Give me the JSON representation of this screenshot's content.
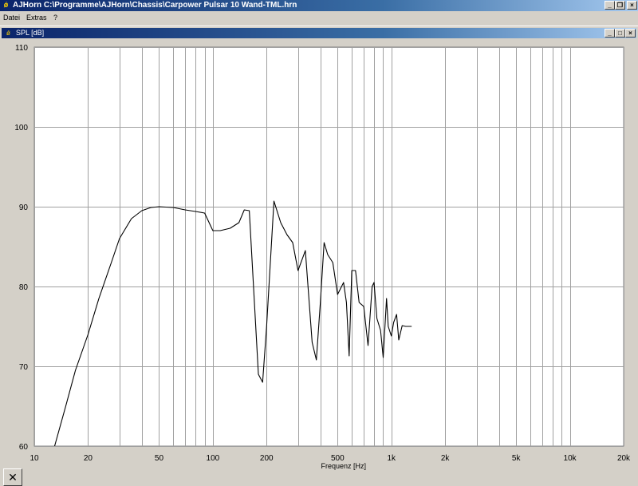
{
  "window": {
    "title": "AJHorn  C:\\Programme\\AJHorn\\Chassis\\Carpower Pulsar 10 Wand-TML.hrn",
    "icon": "aj-icon",
    "buttons": {
      "minimize": "_",
      "restore": "❐",
      "close": "×"
    }
  },
  "menu": {
    "items": [
      "Datei",
      "Extras",
      "?"
    ]
  },
  "subwindow": {
    "title": "SPL [dB]",
    "buttons": {
      "minimize": "_",
      "restore": "□",
      "close": "×"
    }
  },
  "close_button_label": "✕",
  "chart_data": {
    "type": "line",
    "title": "SPL [dB]",
    "xlabel": "Frequenz [Hz]",
    "ylabel": "SPL [dB]",
    "xscale": "log",
    "xlim": [
      10,
      20000
    ],
    "ylim": [
      60,
      110
    ],
    "grid": true,
    "x_ticks": [
      {
        "value": 10,
        "label": "10"
      },
      {
        "value": 20,
        "label": "20"
      },
      {
        "value": 50,
        "label": "50"
      },
      {
        "value": 100,
        "label": "100"
      },
      {
        "value": 200,
        "label": "200"
      },
      {
        "value": 500,
        "label": "500"
      },
      {
        "value": 1000,
        "label": "1k"
      },
      {
        "value": 2000,
        "label": "2k"
      },
      {
        "value": 5000,
        "label": "5k"
      },
      {
        "value": 10000,
        "label": "10k"
      },
      {
        "value": 20000,
        "label": "20k"
      }
    ],
    "y_ticks": [
      60,
      70,
      80,
      90,
      100,
      110
    ],
    "series": [
      {
        "color": "#000000",
        "x": [
          13,
          15,
          17,
          20,
          23,
          27,
          30,
          35,
          40,
          45,
          50,
          60,
          70,
          80,
          90,
          100,
          110,
          125,
          140,
          150,
          160,
          180,
          190,
          200,
          220,
          240,
          260,
          280,
          300,
          330,
          360,
          380,
          400,
          420,
          440,
          470,
          500,
          540,
          560,
          580,
          600,
          630,
          660,
          700,
          740,
          780,
          800,
          830,
          870,
          900,
          940,
          960,
          1000,
          1030,
          1070,
          1100,
          1150,
          1200,
          1250,
          1300
        ],
        "y": [
          60,
          65,
          69.5,
          74,
          78.5,
          83,
          86,
          88.5,
          89.5,
          89.9,
          90,
          89.9,
          89.6,
          89.4,
          89.2,
          87,
          87,
          87.3,
          88,
          89.6,
          89.5,
          69,
          68,
          75,
          90.7,
          88,
          86.5,
          85.5,
          82,
          84.5,
          73,
          70.8,
          78,
          85.5,
          84,
          83,
          79,
          80.5,
          78,
          71.3,
          82,
          82,
          78,
          77.5,
          72.6,
          80,
          80.5,
          76,
          74.5,
          71.1,
          78.5,
          75,
          73.8,
          75.5,
          76.5,
          73.3,
          75.1,
          75,
          75,
          75
        ]
      }
    ]
  }
}
